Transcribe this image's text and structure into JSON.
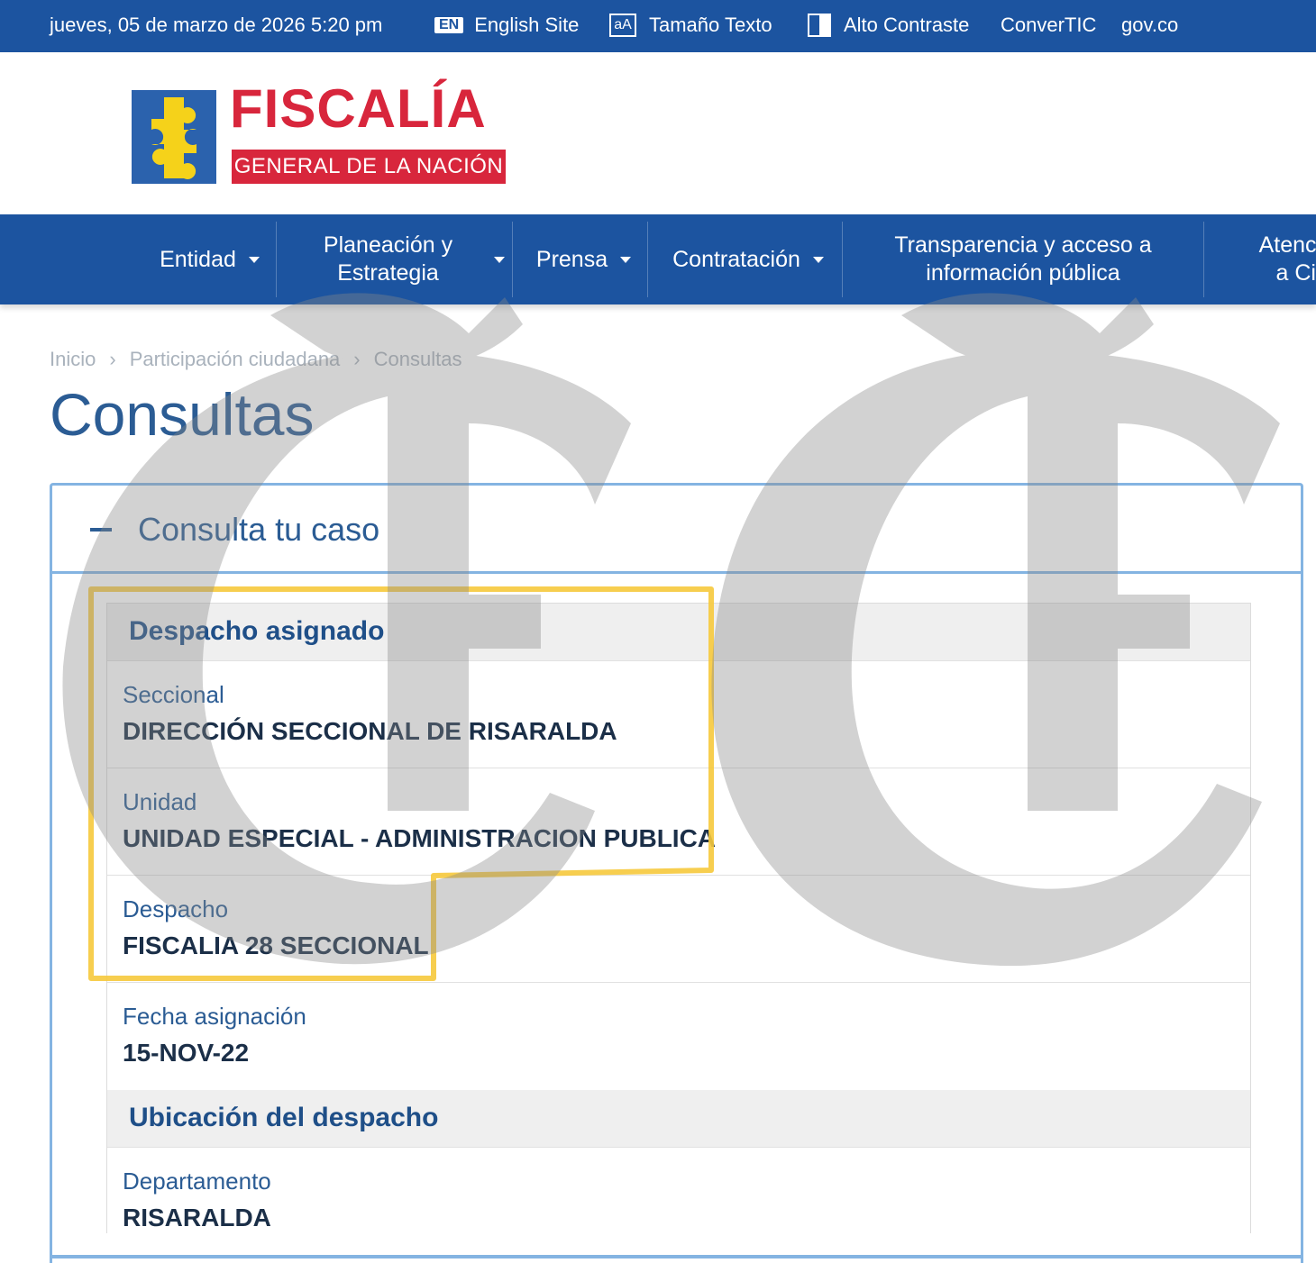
{
  "topbar": {
    "date": "jueves, 05 de marzo de 2026 5:20 pm",
    "english_badge": "EN",
    "english_label": "English Site",
    "text_size_icon": "aA",
    "text_size_label": "Tamaño Texto",
    "contrast_label": "Alto Contraste",
    "convertic_label": "ConverTIC",
    "govco_label": "gov.co"
  },
  "logo": {
    "title": "FISCALÍA",
    "subtitle": "GENERAL DE LA NACIÓN",
    "brand_red": "#d8263c",
    "brand_blue": "#2b62ad",
    "puzzle_color": "#f5d21a"
  },
  "nav": {
    "items": [
      {
        "line1": "Entidad",
        "line2": ""
      },
      {
        "line1": "Planeación y",
        "line2": "Estrategia"
      },
      {
        "line1": "Prensa",
        "line2": ""
      },
      {
        "line1": "Contratación",
        "line2": ""
      },
      {
        "line1": "Transparencia y acceso a",
        "line2": "información pública"
      },
      {
        "line1": "Atenció",
        "line2": "a Ci"
      }
    ],
    "bg": "#1c54a0"
  },
  "breadcrumb": [
    "Inicio",
    "Participación ciudadana",
    "Consultas"
  ],
  "breadcrumb_sep": "›",
  "page_title": "Consultas",
  "accordion": {
    "title": "Consulta tu caso",
    "expanded": true
  },
  "despacho_asignado": {
    "heading": "Despacho asignado",
    "fields": [
      {
        "label": "Seccional",
        "value": "DIRECCIÓN SECCIONAL DE RISARALDA"
      },
      {
        "label": "Unidad",
        "value": "UNIDAD ESPECIAL - ADMINISTRACION PUBLICA"
      },
      {
        "label": "Despacho",
        "value": "FISCALIA 28 SECCIONAL"
      },
      {
        "label": "Fecha asignación",
        "value": "15-NOV-22"
      }
    ]
  },
  "ubicacion": {
    "heading": "Ubicación del despacho",
    "fields": [
      {
        "label": "Departamento",
        "value": "RISARALDA"
      }
    ]
  },
  "highlight_color": "#f6c93c",
  "watermark_text": "EE"
}
